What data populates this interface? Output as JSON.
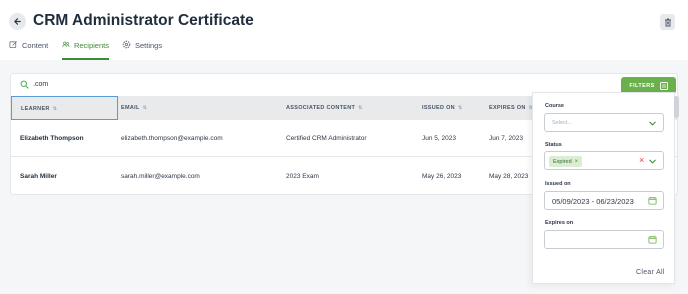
{
  "header": {
    "title": "CRM Administrator Certificate"
  },
  "tabs": [
    {
      "label": "Content",
      "icon": "edit-icon"
    },
    {
      "label": "Recipients",
      "icon": "users-icon",
      "active": true
    },
    {
      "label": "Settings",
      "icon": "gear-icon"
    }
  ],
  "search": {
    "value": ".com"
  },
  "filters_button": {
    "label": "FILTERS"
  },
  "table": {
    "columns": [
      "LEARNER",
      "EMAIL",
      "ASSOCIATED CONTENT",
      "ISSUED ON",
      "EXPIRES ON"
    ],
    "rows": [
      [
        "Elizabeth Thompson",
        "elizabeth.thompson@example.com",
        "Certified CRM Administrator",
        "Jun 5, 2023",
        "Jun 7, 2023"
      ],
      [
        "Sarah Miller",
        "sarah.miller@example.com",
        "2023 Exam",
        "May 26, 2023",
        "May 28, 2023"
      ]
    ]
  },
  "filter_panel": {
    "course": {
      "label": "Course",
      "placeholder": "Select..."
    },
    "status": {
      "label": "Status",
      "chip": "Expired",
      "chip_remove": "×",
      "clear": "×"
    },
    "issued_on": {
      "label": "Issued on",
      "value": "05/09/2023 - 06/23/2023"
    },
    "expires_on": {
      "label": "Expires on",
      "value": ""
    },
    "clear_all": "Clear All"
  },
  "colors": {
    "accent": "#3d8b37",
    "button": "#6ab04c",
    "chip_bg": "#dbeed3",
    "remove": "#e53e3e"
  }
}
